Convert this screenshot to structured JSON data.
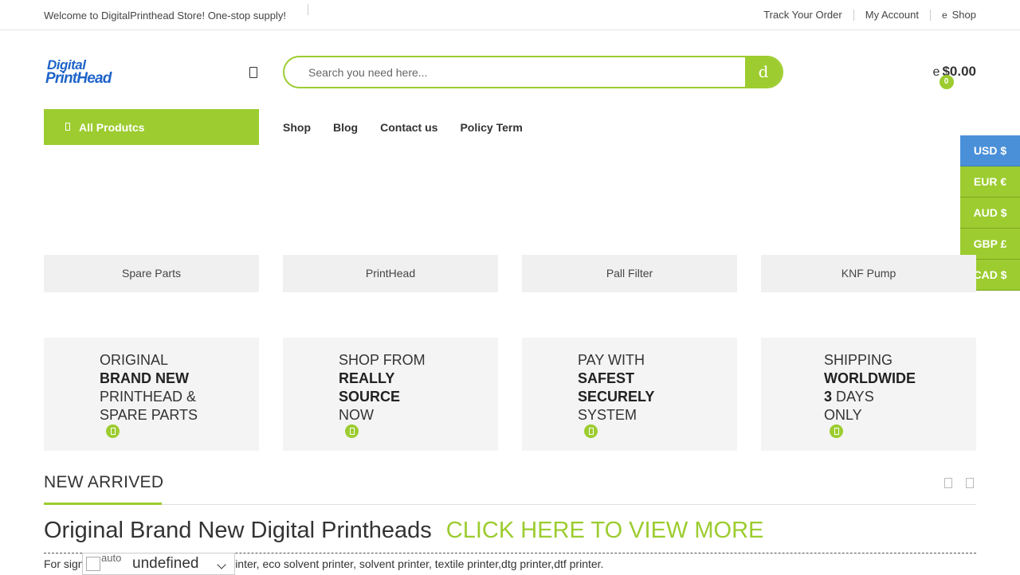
{
  "topbar": {
    "welcome": "Welcome to DigitalPrinthead Store! One-stop supply!",
    "links": [
      "Track Your Order",
      "My Account",
      "Shop"
    ],
    "shop_glyph": "e"
  },
  "logo": {
    "line1": "Digital",
    "line2": "PrintHead"
  },
  "search": {
    "placeholder": "Search you need here...",
    "button_glyph": "d"
  },
  "cart": {
    "glyph": "e",
    "total": "$0.00",
    "count": "0"
  },
  "all_products": {
    "label": "All Produtcs"
  },
  "nav": [
    "Shop",
    "Blog",
    "Contact us",
    "Policy Term"
  ],
  "currency": {
    "options": [
      "USD $",
      "EUR €",
      "AUD $",
      "GBP £",
      "CAD $"
    ],
    "active": "USD $"
  },
  "categories": [
    "Spare Parts",
    "PrintHead",
    "Pall Filter",
    "KNF Pump"
  ],
  "features": [
    {
      "lines": [
        {
          "t": "ORIGINAL",
          "b": false
        },
        {
          "t": "BRAND NEW",
          "b": true
        },
        {
          "t": "PRINTHEAD &",
          "b": false
        },
        {
          "t": "SPARE PARTS",
          "b": false
        }
      ]
    },
    {
      "lines": [
        {
          "t": "SHOP FROM",
          "b": false
        },
        {
          "t": "REALLY",
          "b": true
        },
        {
          "t": "SOURCE",
          "b": true
        },
        {
          "t": "NOW",
          "b": false
        }
      ]
    },
    {
      "lines": [
        {
          "t": "PAY WITH",
          "b": false
        },
        {
          "t": "SAFEST",
          "b": true
        },
        {
          "t": "SECURELY",
          "b": true
        },
        {
          "t": "SYSTEM",
          "b": false
        }
      ]
    },
    {
      "lines": [
        {
          "t": "SHIPPING",
          "b": false
        },
        {
          "t": "WORLDWIDE",
          "b": true
        },
        {
          "t": "3 DAYS",
          "b": false,
          "bold_prefix": "3"
        },
        {
          "t": "ONLY",
          "b": false
        }
      ]
    }
  ],
  "section": {
    "title": "NEW ARRIVED"
  },
  "headline": {
    "text": "Original Brand New Digital Printheads",
    "cta": "CLICK HERE TO VIEW MORE"
  },
  "description": "For signage printer, offset printer, uv printer, eco solvent printer, solvent printer, textile printer,dtg printer,dtf printer.",
  "translate": {
    "img_alt": "auto",
    "value": "undefined"
  },
  "colors": {
    "accent": "#9ccc2f",
    "brand_blue": "#1e63c8",
    "currency_active": "#4a90d9"
  }
}
